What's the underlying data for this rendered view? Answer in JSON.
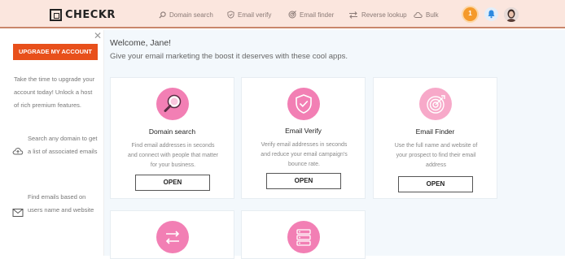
{
  "header": {
    "logo_text": "CHECKR",
    "nav": [
      {
        "label": "Domain search",
        "icon": "search-icon"
      },
      {
        "label": "Email verify",
        "icon": "shield-icon"
      },
      {
        "label": "Email finder",
        "icon": "target-icon"
      },
      {
        "label": "Reverse lookup",
        "icon": "swap-arrows-icon"
      },
      {
        "label": "Bulk",
        "icon": "cloud-icon"
      }
    ],
    "coin_label": "1"
  },
  "sidebar": {
    "upgrade_label": "UPGRADE MY ACCOUNT",
    "upgrade_text": "Take the time to upgrade your account today! Unlock a host of rich premium features.",
    "tip_domain": "Search any domain to get a list of associated emails",
    "tip_find": "Find emails based on users name and website"
  },
  "main": {
    "welcome": "Welcome, Jane!",
    "subtitle": "Give your email marketing the boost it deserves with these cool apps.",
    "cards": [
      {
        "title": "Domain search",
        "description": "Find email addresses in seconds and connect with people that matter for your business.",
        "button": "OPEN"
      },
      {
        "title": "Email Verify",
        "description": "Verify email addresses in seconds and reduce your email campaign's bounce rate.",
        "button": "OPEN"
      },
      {
        "title": "Email Finder",
        "description": "Use the full name and website of your prospect to find their email address",
        "button": "OPEN"
      }
    ]
  },
  "colors": {
    "accent": "#e8501b",
    "icon_pink": "#f27fb4",
    "header_bg": "#fbe6de"
  }
}
